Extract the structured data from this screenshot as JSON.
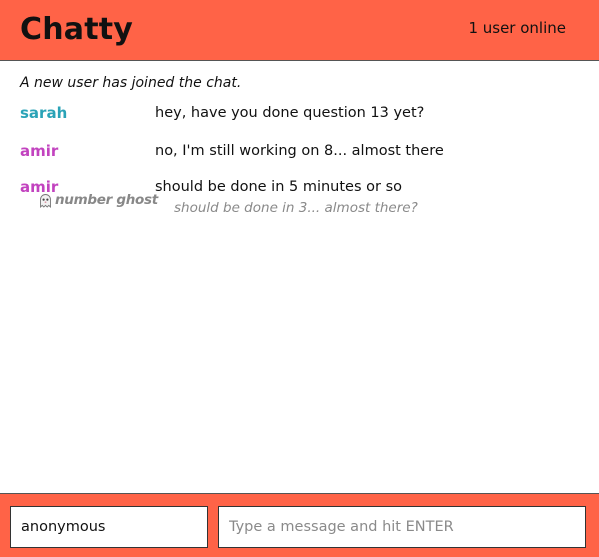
{
  "app": {
    "title": "Chatty",
    "online_status": "1 user online",
    "accent_color": "#ff6347"
  },
  "chat": {
    "system_message": "A new user has joined the chat.",
    "messages": [
      {
        "user": "sarah",
        "user_color": "#2aa3b7",
        "text": "hey, have you done question 13 yet?"
      },
      {
        "user": "amir",
        "user_color": "#c243bf",
        "text": "no, I'm still working on 8... almost there"
      },
      {
        "user": "amir",
        "user_color": "#c243bf",
        "text": "should be done in 5 minutes or so"
      }
    ],
    "ghost": {
      "icon": "ghost-icon",
      "name": "number ghost",
      "text": "should be done in 3... almost there?"
    }
  },
  "composer": {
    "name_value": "anonymous",
    "message_placeholder": "Type a message and hit ENTER"
  }
}
